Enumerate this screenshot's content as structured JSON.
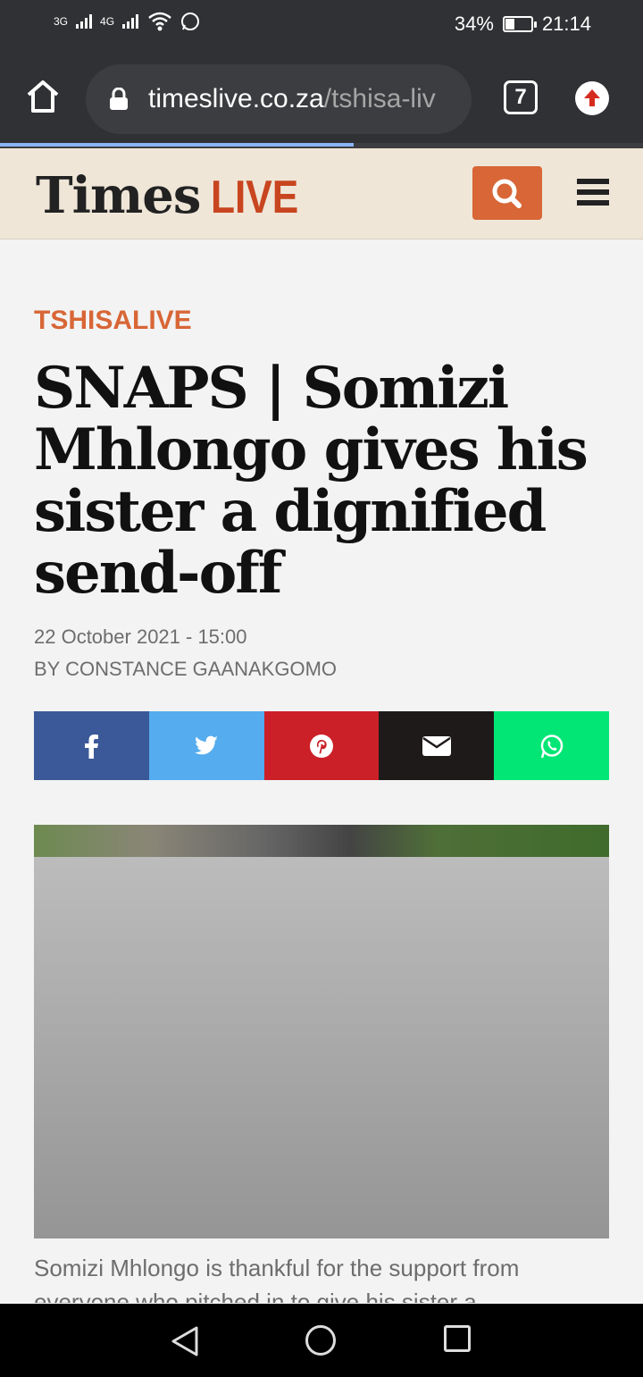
{
  "status_bar": {
    "signal_1": "3G",
    "signal_2": "4G",
    "battery": "34%",
    "battery_fraction": 0.34,
    "time": "21:14"
  },
  "browser": {
    "url_domain": "timeslive.co.za",
    "url_path": "/tshisa-liv",
    "tabs_count": "7",
    "load_progress": 0.55
  },
  "site": {
    "logo_times": "Times",
    "logo_live": "LIVE"
  },
  "article": {
    "section": "TSHISALIVE",
    "headline": "SNAPS | Somizi Mhlongo gives his sister a dignified send-off",
    "date": "22 October 2021 - 15:00",
    "byline": "BY CONSTANCE GAANAKGOMO",
    "caption": "Somizi Mhlongo is thankful for the support from everyone who pitched in to give his sister a"
  },
  "share": [
    {
      "name": "facebook",
      "icon": "facebook-icon",
      "color": "#3b5998"
    },
    {
      "name": "twitter",
      "icon": "twitter-icon",
      "color": "#55acee"
    },
    {
      "name": "pinterest",
      "icon": "pinterest-icon",
      "color": "#cb2027"
    },
    {
      "name": "email",
      "icon": "envelope-icon",
      "color": "#1f1a1a"
    },
    {
      "name": "whatsapp",
      "icon": "whatsapp-icon",
      "color": "#01e675"
    }
  ],
  "colors": {
    "accent": "#d86636",
    "live": "#c8451f",
    "header_bg": "#efe6d8"
  }
}
